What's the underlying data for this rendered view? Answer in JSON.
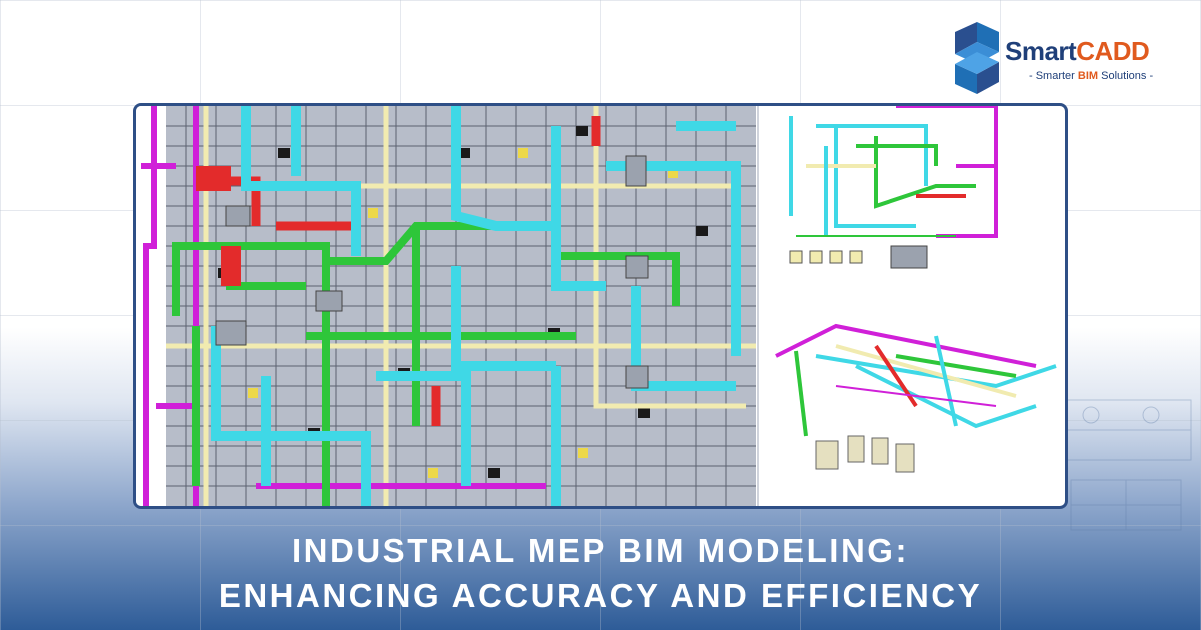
{
  "brand": {
    "name_part1": "Smart",
    "name_part2": "CADD",
    "tagline_prefix": "- Smarter ",
    "tagline_highlight": "BIM",
    "tagline_suffix": " Solutions -",
    "colors": {
      "navy": "#1f3f79",
      "orange": "#e05a1e"
    }
  },
  "illustration": {
    "icon": "mep-bim-model-image"
  },
  "headline": {
    "line1": "INDUSTRIAL MEP BIM MODELING:",
    "line2": "ENHANCING ACCURACY AND EFFICIENCY"
  },
  "colors": {
    "frame_border": "#2e4f86",
    "duct_cyan": "#3fd8e6",
    "pipe_green": "#2ec63a",
    "pipe_magenta": "#d020d8",
    "pipe_red": "#e32b2b",
    "pipe_cream": "#f1ebb0"
  }
}
